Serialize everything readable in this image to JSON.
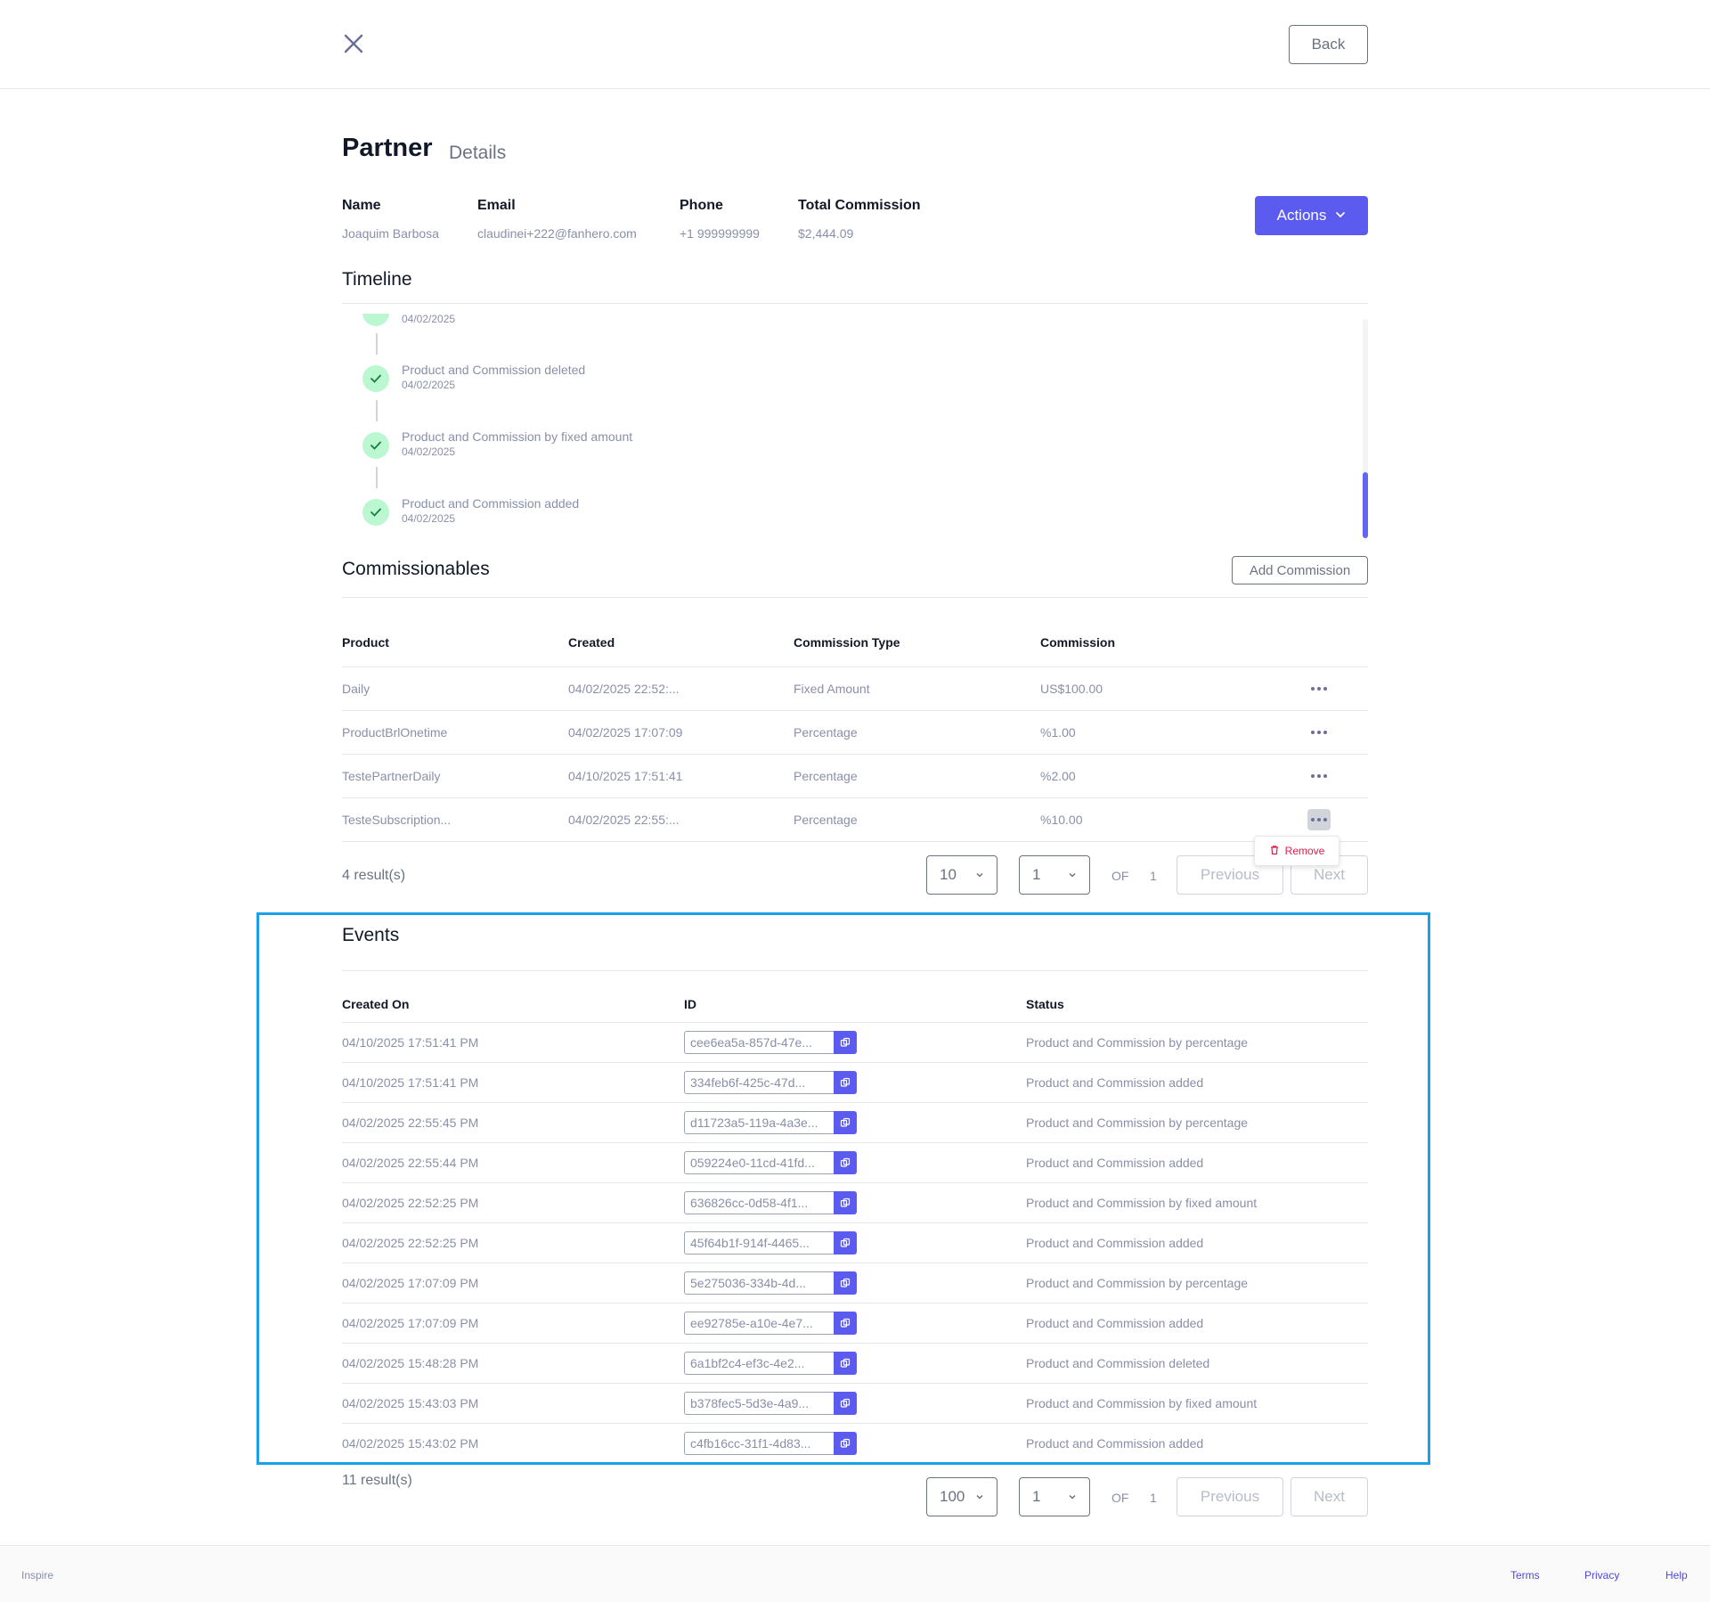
{
  "header": {
    "back_label": "Back"
  },
  "page": {
    "title": "Partner",
    "subtitle": "Details"
  },
  "partner": {
    "name_label": "Name",
    "name": "Joaquim Barbosa",
    "email_label": "Email",
    "email": "claudinei+222@fanhero.com",
    "phone_label": "Phone",
    "phone": "+1 999999999",
    "commission_label": "Total Commission",
    "commission": "$2,444.09"
  },
  "actions_label": "Actions",
  "timeline": {
    "title": "Timeline",
    "items": [
      {
        "text": "",
        "date": "04/02/2025"
      },
      {
        "text": "Product and Commission deleted",
        "date": "04/02/2025"
      },
      {
        "text": "Product and Commission by fixed amount",
        "date": "04/02/2025"
      },
      {
        "text": "Product and Commission added",
        "date": "04/02/2025"
      }
    ]
  },
  "commissionables": {
    "title": "Commissionables",
    "add_label": "Add Commission",
    "columns": [
      "Product",
      "Created",
      "Commission Type",
      "Commission"
    ],
    "rows": [
      {
        "product": "Daily",
        "created": "04/02/2025 22:52:...",
        "type": "Fixed Amount",
        "commission": "US$100.00"
      },
      {
        "product": "ProductBrlOnetime",
        "created": "04/02/2025 17:07:09",
        "type": "Percentage",
        "commission": "%1.00"
      },
      {
        "product": "TestePartnerDaily",
        "created": "04/10/2025 17:51:41",
        "type": "Percentage",
        "commission": "%2.00"
      },
      {
        "product": "TesteSubscription...",
        "created": "04/02/2025 22:55:...",
        "type": "Percentage",
        "commission": "%10.00"
      }
    ],
    "remove_label": "Remove",
    "results": "4 result(s)",
    "page_size": "10",
    "page": "1",
    "of_label": "OF",
    "total_pages": "1",
    "previous_label": "Previous",
    "next_label": "Next"
  },
  "events": {
    "title": "Events",
    "columns": [
      "Created On",
      "ID",
      "Status"
    ],
    "rows": [
      {
        "created": "04/10/2025 17:51:41 PM",
        "id": "cee6ea5a-857d-47e...",
        "status": "Product and Commission by percentage"
      },
      {
        "created": "04/10/2025 17:51:41 PM",
        "id": "334feb6f-425c-47d...",
        "status": "Product and Commission added"
      },
      {
        "created": "04/02/2025 22:55:45 PM",
        "id": "d11723a5-119a-4a3e...",
        "status": "Product and Commission by percentage"
      },
      {
        "created": "04/02/2025 22:55:44 PM",
        "id": "059224e0-11cd-41fd...",
        "status": "Product and Commission added"
      },
      {
        "created": "04/02/2025 22:52:25 PM",
        "id": "636826cc-0d58-4f1...",
        "status": "Product and Commission by fixed amount"
      },
      {
        "created": "04/02/2025 22:52:25 PM",
        "id": "45f64b1f-914f-4465...",
        "status": "Product and Commission added"
      },
      {
        "created": "04/02/2025 17:07:09 PM",
        "id": "5e275036-334b-4d...",
        "status": "Product and Commission by percentage"
      },
      {
        "created": "04/02/2025 17:07:09 PM",
        "id": "ee92785e-a10e-4e7...",
        "status": "Product and Commission added"
      },
      {
        "created": "04/02/2025 15:48:28 PM",
        "id": "6a1bf2c4-ef3c-4e2...",
        "status": "Product and Commission deleted"
      },
      {
        "created": "04/02/2025 15:43:03 PM",
        "id": "b378fec5-5d3e-4a9...",
        "status": "Product and Commission by fixed amount"
      },
      {
        "created": "04/02/2025 15:43:02 PM",
        "id": "c4fb16cc-31f1-4d83...",
        "status": "Product and Commission added"
      }
    ],
    "results": "11 result(s)",
    "page_size": "100",
    "page": "1",
    "of_label": "OF",
    "total_pages": "1",
    "previous_label": "Previous",
    "next_label": "Next"
  },
  "footer": {
    "brand": "Inspire",
    "terms": "Terms",
    "privacy": "Privacy",
    "help": "Help"
  },
  "colors": {
    "accent": "#5b5bf0",
    "success_bg": "#bbf7d0",
    "danger": "#e11d48",
    "highlight_border": "#1aa0e8"
  },
  "icons": {
    "close": "close-icon",
    "chevron": "chevron-down-icon",
    "check": "check-icon",
    "copy": "copy-icon",
    "trash": "trash-icon",
    "more": "more-horizontal-icon"
  }
}
